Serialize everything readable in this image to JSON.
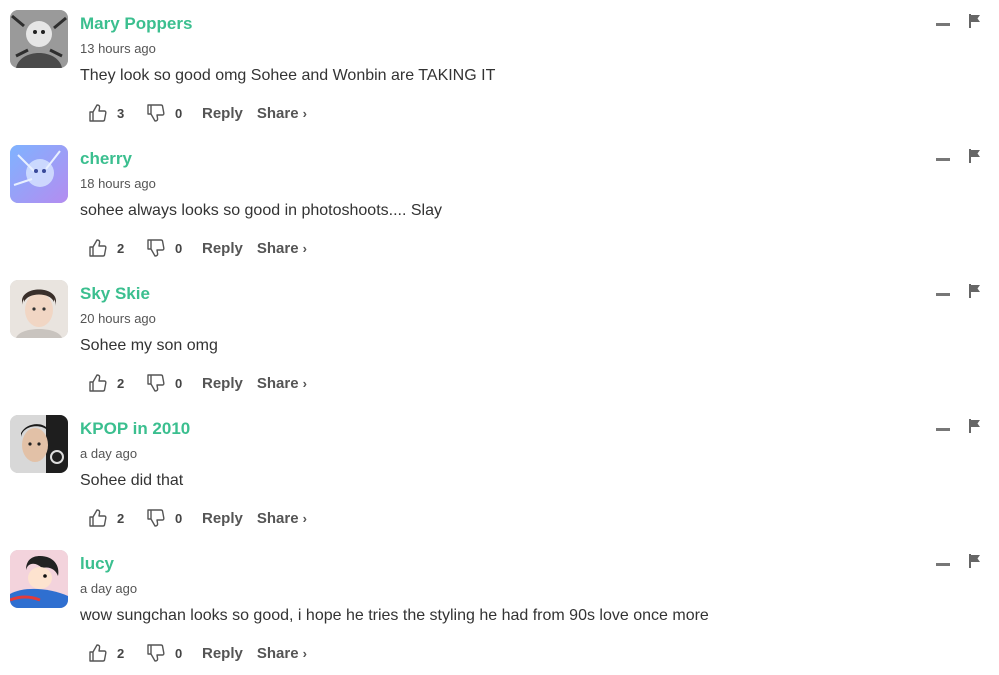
{
  "comments": [
    {
      "author": "Mary Poppers",
      "time": "13 hours ago",
      "text": "They look so good omg Sohee and Wonbin are TAKING IT",
      "likes": "3",
      "dislikes": "0",
      "reply_label": "Reply",
      "share_label": "Share",
      "avatar": "grayscale-illustration"
    },
    {
      "author": "cherry",
      "time": "18 hours ago",
      "text": "sohee always looks so good in photoshoots.... Slay",
      "likes": "2",
      "dislikes": "0",
      "reply_label": "Reply",
      "share_label": "Share",
      "avatar": "blue-purple-anime"
    },
    {
      "author": "Sky Skie",
      "time": "20 hours ago",
      "text": "Sohee my son omg",
      "likes": "2",
      "dislikes": "0",
      "reply_label": "Reply",
      "share_label": "Share",
      "avatar": "photo-person"
    },
    {
      "author": "KPOP in 2010",
      "time": "a day ago",
      "text": "Sohee did that",
      "likes": "2",
      "dislikes": "0",
      "reply_label": "Reply",
      "share_label": "Share",
      "avatar": "photo-person-dark"
    },
    {
      "author": "lucy",
      "time": "a day ago",
      "text": "wow sungchan looks so good, i hope he tries the styling he had from 90s love once more",
      "likes": "2",
      "dislikes": "0",
      "reply_label": "Reply",
      "share_label": "Share",
      "avatar": "cartoon-character"
    }
  ],
  "colors": {
    "author": "#3bbf8f",
    "text": "#333333",
    "meta": "#555555"
  },
  "icons": {
    "like": "thumbs-up-icon",
    "dislike": "thumbs-down-icon",
    "share_chevron": "chevron-right-icon",
    "minimize": "minimize-icon",
    "flag": "flag-icon"
  }
}
